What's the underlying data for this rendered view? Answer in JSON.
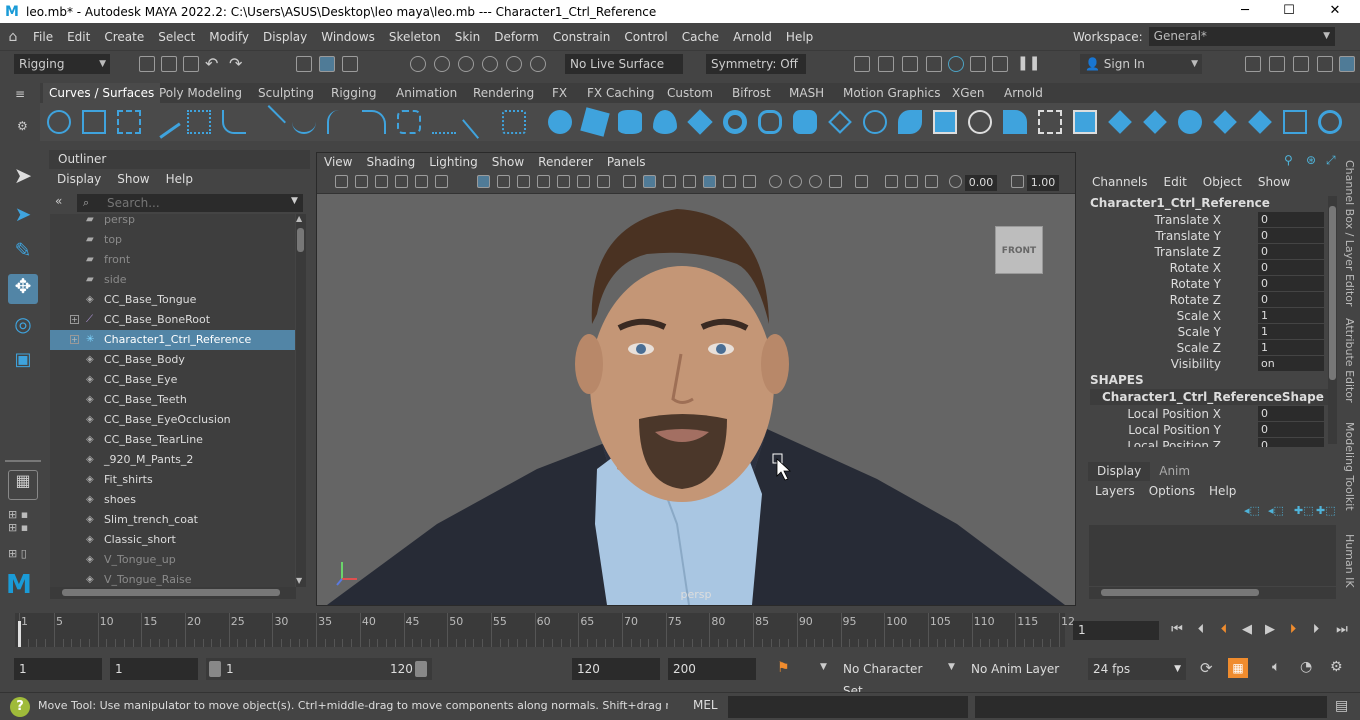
{
  "titlebar": {
    "title": "leo.mb* - Autodesk MAYA 2022.2: C:\\Users\\ASUS\\Desktop\\leo maya\\leo.mb  ---  Character1_Ctrl_Reference",
    "minimize": "─",
    "maximize": "☐",
    "close": "✕"
  },
  "menubar": {
    "items": [
      "File",
      "Edit",
      "Create",
      "Select",
      "Modify",
      "Display",
      "Windows",
      "Skeleton",
      "Skin",
      "Deform",
      "Constrain",
      "Control",
      "Cache",
      "Arnold",
      "Help"
    ],
    "workspace_label": "Workspace:",
    "workspace_value": "General*"
  },
  "statusline": {
    "menuset": "Rigging",
    "live_surface": "No Live Surface",
    "symmetry": "Symmetry: Off",
    "sign_in": "Sign In"
  },
  "shelf": {
    "tabs": [
      "Curves / Surfaces",
      "Poly Modeling",
      "Sculpting",
      "Rigging",
      "Animation",
      "Rendering",
      "FX",
      "FX Caching",
      "Custom",
      "Bifrost",
      "MASH",
      "Motion Graphics",
      "XGen",
      "Arnold"
    ],
    "active_tab": "Curves / Surfaces"
  },
  "outliner": {
    "title": "Outliner",
    "menu": [
      "Display",
      "Show",
      "Help"
    ],
    "search_placeholder": "Search...",
    "items": [
      {
        "label": "persp",
        "icon": "camera-icon",
        "dim": true
      },
      {
        "label": "top",
        "icon": "camera-icon",
        "dim": true
      },
      {
        "label": "front",
        "icon": "camera-icon",
        "dim": true
      },
      {
        "label": "side",
        "icon": "camera-icon",
        "dim": true
      },
      {
        "label": "CC_Base_Tongue",
        "icon": "mesh-icon"
      },
      {
        "label": "CC_Base_BoneRoot",
        "icon": "joint-icon",
        "expand": "+"
      },
      {
        "label": "Character1_Ctrl_Reference",
        "icon": "locator-icon",
        "expand": "+",
        "selected": true
      },
      {
        "label": "CC_Base_Body",
        "icon": "mesh-icon"
      },
      {
        "label": "CC_Base_Eye",
        "icon": "mesh-icon"
      },
      {
        "label": "CC_Base_Teeth",
        "icon": "mesh-icon"
      },
      {
        "label": "CC_Base_EyeOcclusion",
        "icon": "mesh-icon"
      },
      {
        "label": "CC_Base_TearLine",
        "icon": "mesh-icon"
      },
      {
        "label": "_920_M_Pants_2",
        "icon": "mesh-icon"
      },
      {
        "label": "Fit_shirts",
        "icon": "mesh-icon"
      },
      {
        "label": "shoes",
        "icon": "mesh-icon"
      },
      {
        "label": "Slim_trench_coat",
        "icon": "mesh-icon"
      },
      {
        "label": "Classic_short",
        "icon": "mesh-icon"
      },
      {
        "label": "V_Tongue_up",
        "icon": "mesh-icon",
        "dim": true
      },
      {
        "label": "V_Tongue_Raise",
        "icon": "mesh-icon",
        "dim": true
      }
    ]
  },
  "viewport": {
    "menu": [
      "View",
      "Shading",
      "Lighting",
      "Show",
      "Renderer",
      "Panels"
    ],
    "field1": "0.00",
    "field2": "1.00",
    "viewcube": "FRONT",
    "camera": "persp"
  },
  "channelbox": {
    "menu": [
      "Channels",
      "Edit",
      "Object",
      "Show"
    ],
    "object": "Character1_Ctrl_Reference",
    "channels": [
      {
        "label": "Translate X",
        "value": "0"
      },
      {
        "label": "Translate Y",
        "value": "0"
      },
      {
        "label": "Translate Z",
        "value": "0"
      },
      {
        "label": "Rotate X",
        "value": "0"
      },
      {
        "label": "Rotate Y",
        "value": "0"
      },
      {
        "label": "Rotate Z",
        "value": "0"
      },
      {
        "label": "Scale X",
        "value": "1"
      },
      {
        "label": "Scale Y",
        "value": "1"
      },
      {
        "label": "Scale Z",
        "value": "1"
      },
      {
        "label": "Visibility",
        "value": "on"
      }
    ],
    "shapes_header": "SHAPES",
    "shape_name": "Character1_Ctrl_ReferenceShape",
    "shape_channels": [
      {
        "label": "Local Position X",
        "value": "0"
      },
      {
        "label": "Local Position Y",
        "value": "0"
      },
      {
        "label": "Local Position Z",
        "value": "0"
      }
    ]
  },
  "sidetabs": [
    "Channel Box / Layer Editor",
    "Attribute Editor",
    "Modeling Toolkit",
    "Human IK"
  ],
  "layereditor": {
    "tabs": [
      "Display",
      "Anim"
    ],
    "menu": [
      "Layers",
      "Options",
      "Help"
    ]
  },
  "timeslider": {
    "ticks": [
      "1",
      "5",
      "10",
      "15",
      "20",
      "25",
      "30",
      "35",
      "40",
      "45",
      "50",
      "55",
      "60",
      "65",
      "70",
      "75",
      "80",
      "85",
      "90",
      "95",
      "100",
      "105",
      "110",
      "115",
      "12"
    ],
    "current_frame": "1"
  },
  "rangebar": {
    "start": "1",
    "playback_start": "1",
    "range_start": "1",
    "range_end": "120",
    "playback_end": "120",
    "end": "200",
    "character_set": "No Character Set",
    "anim_layer": "No Anim Layer",
    "fps": "24 fps"
  },
  "helpline": {
    "message": "Move Tool: Use manipulator to move object(s). Ctrl+middle-drag to move components along normals. Shift+drag manipulator axis or plane ha",
    "mel": "MEL"
  }
}
